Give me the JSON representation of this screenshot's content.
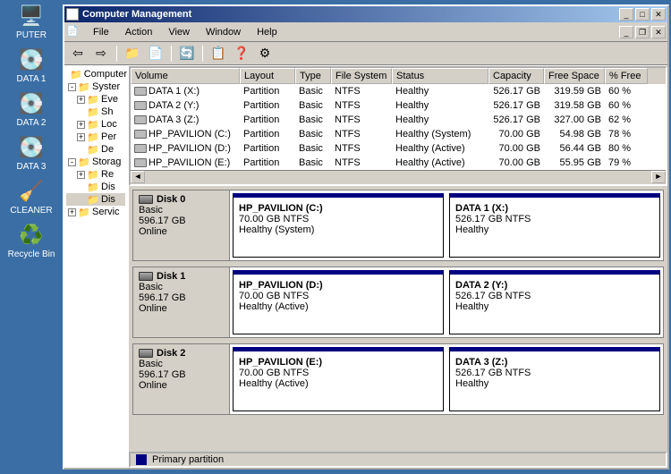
{
  "desktop": {
    "icons": [
      {
        "name": "computer",
        "label": "PUTER",
        "glyph": "🖥️"
      },
      {
        "name": "drive",
        "label": "DATA 1",
        "glyph": "💽"
      },
      {
        "name": "drive",
        "label": "DATA 2",
        "glyph": "💽"
      },
      {
        "name": "drive",
        "label": "DATA 3",
        "glyph": "💽"
      },
      {
        "name": "cleaner",
        "label": "CLEANER",
        "glyph": "🧹"
      },
      {
        "name": "recycle",
        "label": "Recycle Bin",
        "glyph": "♻️"
      }
    ]
  },
  "window": {
    "title": "Computer Management",
    "menu": [
      "File",
      "Action",
      "View",
      "Window",
      "Help"
    ],
    "toolbar": [
      {
        "name": "back-icon",
        "glyph": "⇦"
      },
      {
        "name": "forward-icon",
        "glyph": "⇨"
      },
      {
        "name": "up-folder-icon",
        "glyph": "📁"
      },
      {
        "name": "properties-icon",
        "glyph": "📄"
      },
      {
        "name": "refresh-icon",
        "glyph": "🔄"
      },
      {
        "name": "export-icon",
        "glyph": "📋"
      },
      {
        "name": "help-icon",
        "glyph": "❓"
      },
      {
        "name": "settings-icon",
        "glyph": "⚙"
      }
    ],
    "tree": [
      {
        "depth": 0,
        "box": "",
        "label": "Computer"
      },
      {
        "depth": 0,
        "box": "-",
        "label": "Syster"
      },
      {
        "depth": 1,
        "box": "+",
        "label": "Eve"
      },
      {
        "depth": 1,
        "box": "",
        "label": "Sh"
      },
      {
        "depth": 1,
        "box": "+",
        "label": "Loc"
      },
      {
        "depth": 1,
        "box": "+",
        "label": "Per"
      },
      {
        "depth": 1,
        "box": "",
        "label": "De"
      },
      {
        "depth": 0,
        "box": "-",
        "label": "Storag"
      },
      {
        "depth": 1,
        "box": "+",
        "label": "Re"
      },
      {
        "depth": 1,
        "box": "",
        "label": "Dis"
      },
      {
        "depth": 1,
        "box": "",
        "label": "Dis",
        "sel": true
      },
      {
        "depth": 0,
        "box": "+",
        "label": "Servic"
      }
    ],
    "columns": [
      "Volume",
      "Layout",
      "Type",
      "File System",
      "Status",
      "Capacity",
      "Free Space",
      "% Free"
    ],
    "volumes": [
      {
        "name": "DATA 1 (X:)",
        "layout": "Partition",
        "type": "Basic",
        "fs": "NTFS",
        "status": "Healthy",
        "cap": "526.17 GB",
        "free": "319.59 GB",
        "pct": "60 %"
      },
      {
        "name": "DATA 2 (Y:)",
        "layout": "Partition",
        "type": "Basic",
        "fs": "NTFS",
        "status": "Healthy",
        "cap": "526.17 GB",
        "free": "319.58 GB",
        "pct": "60 %"
      },
      {
        "name": "DATA 3 (Z:)",
        "layout": "Partition",
        "type": "Basic",
        "fs": "NTFS",
        "status": "Healthy",
        "cap": "526.17 GB",
        "free": "327.00 GB",
        "pct": "62 %"
      },
      {
        "name": "HP_PAVILION (C:)",
        "layout": "Partition",
        "type": "Basic",
        "fs": "NTFS",
        "status": "Healthy (System)",
        "cap": "70.00 GB",
        "free": "54.98 GB",
        "pct": "78 %"
      },
      {
        "name": "HP_PAVILION (D:)",
        "layout": "Partition",
        "type": "Basic",
        "fs": "NTFS",
        "status": "Healthy (Active)",
        "cap": "70.00 GB",
        "free": "56.44 GB",
        "pct": "80 %"
      },
      {
        "name": "HP_PAVILION (E:)",
        "layout": "Partition",
        "type": "Basic",
        "fs": "NTFS",
        "status": "Healthy (Active)",
        "cap": "70.00 GB",
        "free": "55.95 GB",
        "pct": "79 %"
      }
    ],
    "disks": [
      {
        "title": "Disk 0",
        "type": "Basic",
        "size": "596.17 GB",
        "state": "Online",
        "parts": [
          {
            "name": "HP_PAVILION  (C:)",
            "info": "70.00 GB NTFS",
            "status": "Healthy (System)"
          },
          {
            "name": "DATA 1  (X:)",
            "info": "526.17 GB NTFS",
            "status": "Healthy"
          }
        ]
      },
      {
        "title": "Disk 1",
        "type": "Basic",
        "size": "596.17 GB",
        "state": "Online",
        "parts": [
          {
            "name": "HP_PAVILION  (D:)",
            "info": "70.00 GB NTFS",
            "status": "Healthy (Active)"
          },
          {
            "name": "DATA 2  (Y:)",
            "info": "526.17 GB NTFS",
            "status": "Healthy"
          }
        ]
      },
      {
        "title": "Disk 2",
        "type": "Basic",
        "size": "596.17 GB",
        "state": "Online",
        "parts": [
          {
            "name": "HP_PAVILION  (E:)",
            "info": "70.00 GB NTFS",
            "status": "Healthy (Active)"
          },
          {
            "name": "DATA 3  (Z:)",
            "info": "526.17 GB NTFS",
            "status": "Healthy"
          }
        ]
      }
    ],
    "legend": "Primary partition"
  }
}
